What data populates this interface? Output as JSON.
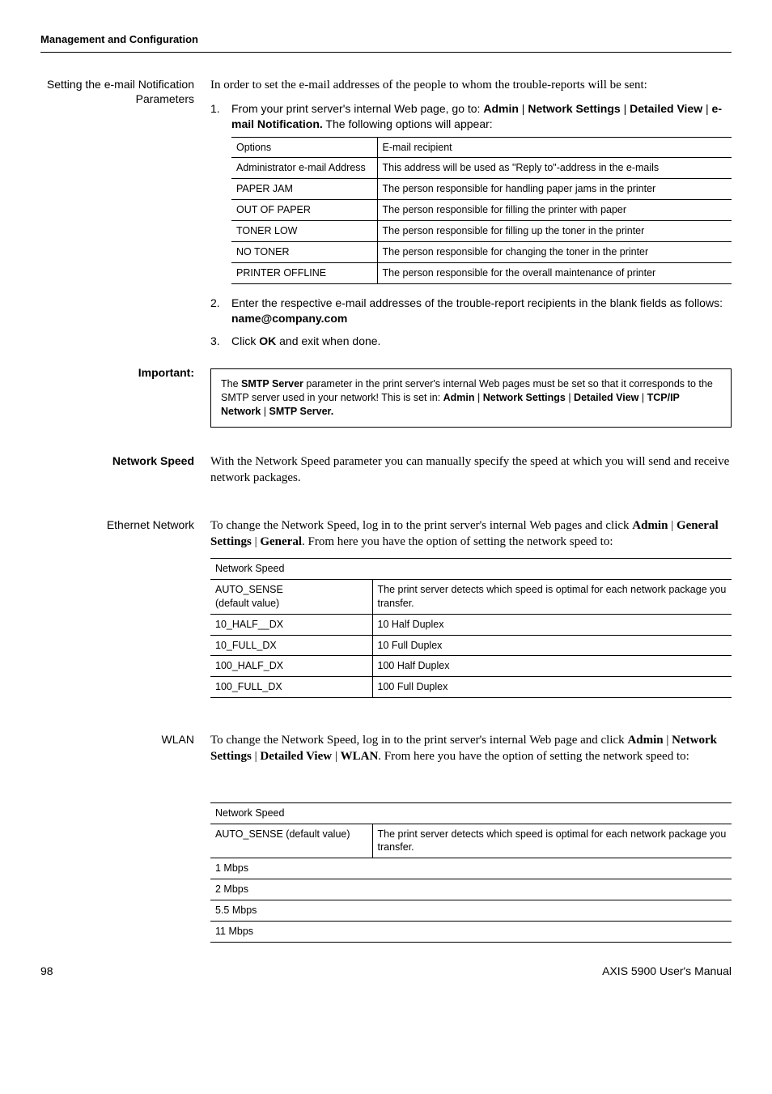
{
  "header": {
    "section": "Management and Configuration"
  },
  "block1": {
    "side_label": "Setting the e-mail Notification Parameters",
    "intro": "In order to set the e-mail addresses of the people to whom the trouble-reports will be sent:",
    "step1_pre": "From your print server's internal Web page, go to: ",
    "step1_b1": "Admin",
    "step1_p1": " | ",
    "step1_b2": "Network Settings",
    "step1_p2": " | ",
    "step1_b3": "Detailed View",
    "step1_p3": " | ",
    "step1_b4": "e-mail Notification.",
    "step1_post": " The following options will appear:",
    "table": {
      "r0c0": "Options",
      "r0c1": "E-mail recipient",
      "r1c0": "Administrator e-mail Address",
      "r1c1": "This address will be used as \"Reply to\"-address in the e-mails",
      "r2c0": "PAPER JAM",
      "r2c1": "The person responsible for handling paper jams in the printer",
      "r3c0": "OUT OF PAPER",
      "r3c1": "The person responsible for filling the printer with paper",
      "r4c0": "TONER LOW",
      "r4c1": "The person responsible for filling up the toner in the printer",
      "r5c0": "NO TONER",
      "r5c1": "The person responsible for changing the toner in the printer",
      "r6c0": "PRINTER OFFLINE",
      "r6c1": "The person responsible for the overall maintenance of printer"
    },
    "step2_text": "Enter the respective e-mail addresses of the trouble-report recipients in the blank fields as follows:",
    "step2_example": "name@company.com",
    "step3_pre": "Click ",
    "step3_b": "OK",
    "step3_post": " and exit when done."
  },
  "important": {
    "label": "Important:",
    "note_pre": "The ",
    "note_b1": "SMTP Server",
    "note_mid1": " parameter in the print server's internal Web pages must be set so that it corresponds to the SMTP server used in your network! This is set in: ",
    "note_b2": "Admin",
    "p1": " | ",
    "note_b3": "Network Settings",
    "p2": " | ",
    "note_b4": "Detailed View",
    "p3": " | ",
    "note_b5": "TCP/IP Network",
    "p4": " | ",
    "note_b6": "SMTP Server."
  },
  "netspeed": {
    "label": "Network Speed",
    "text": "With the Network Speed parameter you can manually specify the speed at which you will send and receive network packages."
  },
  "ethernet": {
    "label": "Ethernet Network",
    "text_pre": "To change the Network Speed, log in to the print server's internal Web pages and click ",
    "b1": "Admin",
    "p1": " | ",
    "b2": "General Settings",
    "p2": " | ",
    "b3": "General",
    "text_post": ". From here you have the option of setting the network speed to:",
    "table": {
      "hdr": "Network Speed",
      "r1c0a": "AUTO_SENSE",
      "r1c0b": "(default value)",
      "r1c1": "The print server detects which speed is optimal for each network package you transfer.",
      "r2c0": "10_HALF__DX",
      "r2c1": "10 Half Duplex",
      "r3c0": "10_FULL_DX",
      "r3c1": "10 Full Duplex",
      "r4c0": "100_HALF_DX",
      "r4c1": "100 Half Duplex",
      "r5c0": "100_FULL_DX",
      "r5c1": "100 Full Duplex"
    }
  },
  "wlan": {
    "label": "WLAN",
    "text_pre": "To change the Network Speed, log in to the print server's internal Web page and click ",
    "b1": "Admin",
    "p1": " | ",
    "b2": "Network Settings",
    "p2": " | ",
    "b3": "Detailed View",
    "p3": " | ",
    "b4": "WLAN",
    "text_post": ". From here you have the option of setting the network speed to:",
    "table": {
      "hdr": "Network Speed",
      "r1c0": "AUTO_SENSE (default value)",
      "r1c1": "The print server detects which speed is optimal for each network package you transfer.",
      "r2c0": "1 Mbps",
      "r3c0": "2 Mbps",
      "r4c0": "5.5 Mbps",
      "r5c0": "11 Mbps"
    }
  },
  "footer": {
    "page": "98",
    "manual": "AXIS 5900 User's Manual"
  }
}
